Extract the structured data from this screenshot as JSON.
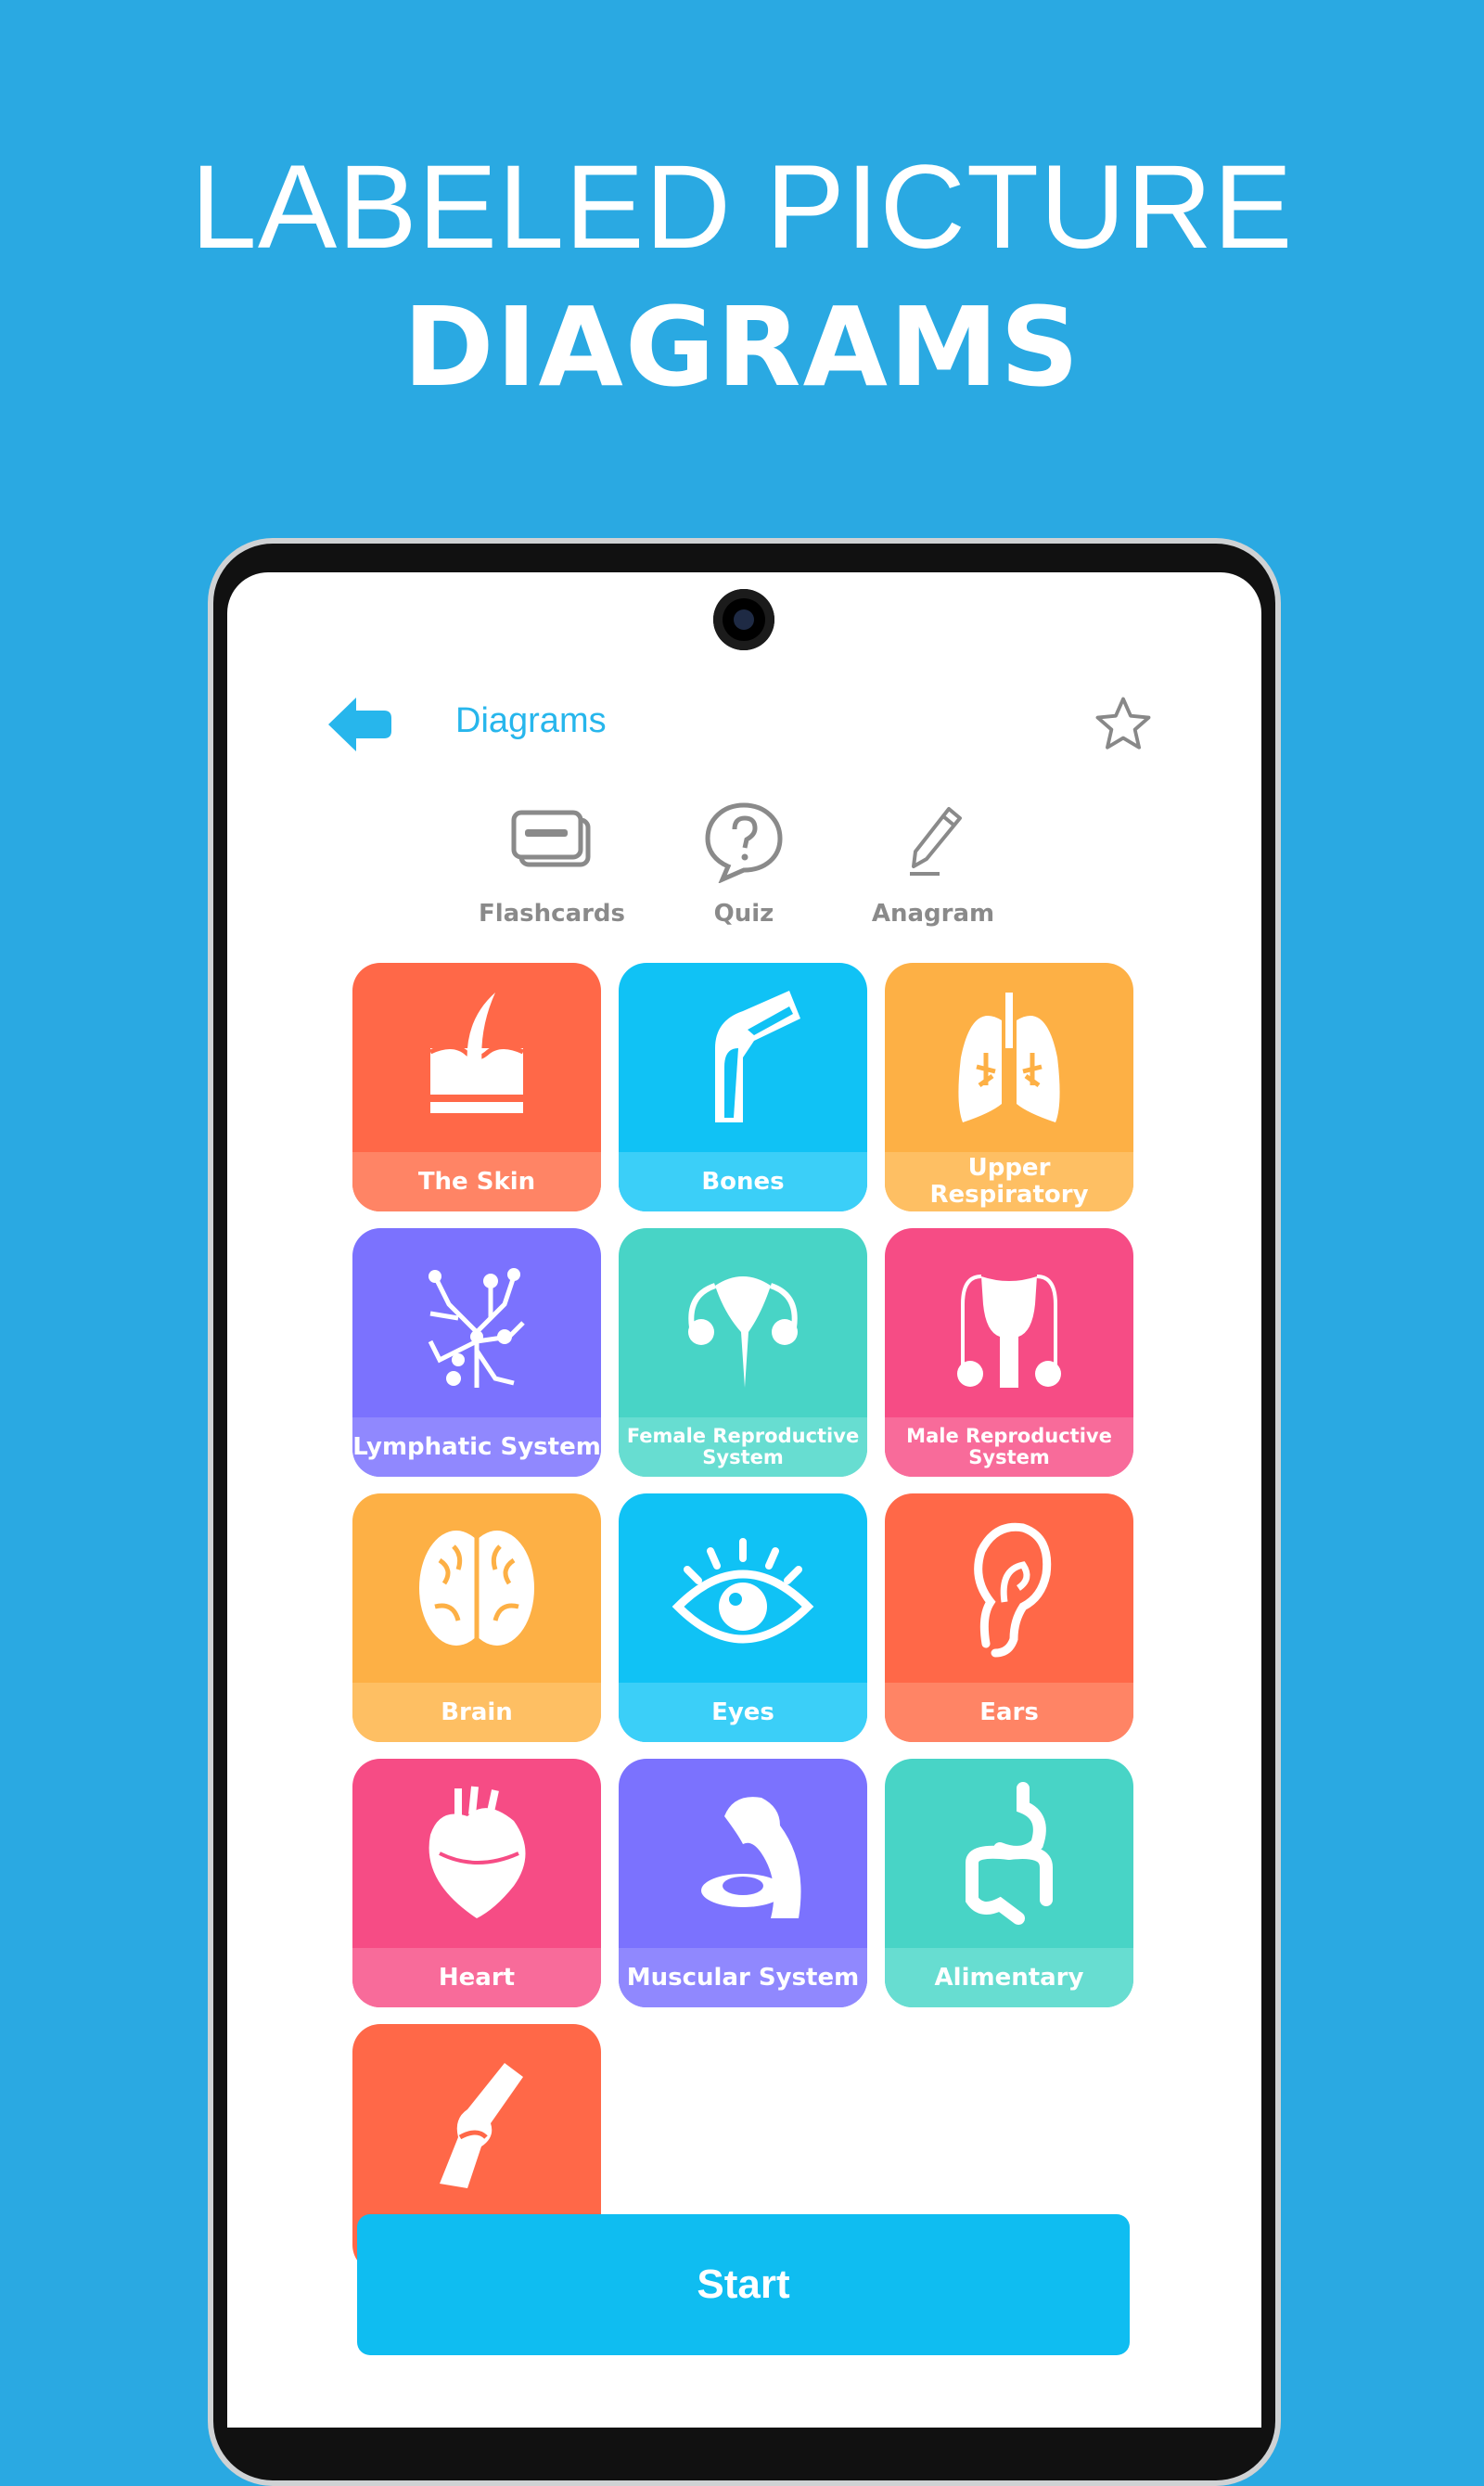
{
  "headline": {
    "line1": "LABELED PICTURE",
    "line2": "DIAGRAMS"
  },
  "header": {
    "title": "Diagrams",
    "back_icon": "arrow-left-icon",
    "favorite_icon": "star-outline-icon",
    "accent": "#27B6EC"
  },
  "modes": [
    {
      "label": "Flashcards",
      "icon": "flashcards-icon"
    },
    {
      "label": "Quiz",
      "icon": "question-bubble-icon"
    },
    {
      "label": "Anagram",
      "icon": "pencil-icon"
    }
  ],
  "tiles": [
    {
      "label": "The Skin",
      "icon": "skin-icon",
      "color": "#FF6848",
      "band": "#FF8465"
    },
    {
      "label": "Bones",
      "icon": "bone-joint-icon",
      "color": "#10C2F5",
      "band": "#3BCFF8"
    },
    {
      "label": "Upper Respiratory",
      "icon": "lungs-icon",
      "color": "#FDB045",
      "band": "#FEBF63"
    },
    {
      "label": "Lymphatic System",
      "icon": "lymph-icon",
      "color": "#7B72FE",
      "band": "#9088FE"
    },
    {
      "label": "Female Reproductive System",
      "icon": "uterus-icon",
      "color": "#48D4C6",
      "band": "#67DDD1"
    },
    {
      "label": "Male Reproductive System",
      "icon": "male-reproductive-icon",
      "color": "#F64C85",
      "band": "#F86B9A"
    },
    {
      "label": "Brain",
      "icon": "brain-icon",
      "color": "#FDB045",
      "band": "#FEBF63"
    },
    {
      "label": "Eyes",
      "icon": "eye-icon",
      "color": "#10C2F5",
      "band": "#3BCFF8"
    },
    {
      "label": "Ears",
      "icon": "ear-icon",
      "color": "#FF6848",
      "band": "#FF8465"
    },
    {
      "label": "Heart",
      "icon": "heart-icon",
      "color": "#F64C85",
      "band": "#F86B9A"
    },
    {
      "label": "Muscular System",
      "icon": "muscle-icon",
      "color": "#7B72FE",
      "band": "#9088FE"
    },
    {
      "label": "Alimentary",
      "icon": "intestine-icon",
      "color": "#48D4C6",
      "band": "#67DDD1"
    },
    {
      "label": "",
      "icon": "knee-icon",
      "color": "#FF6848",
      "band": "#FF6848"
    }
  ],
  "start_label": "Start",
  "colors": {
    "background": "#2AA9E2",
    "start": "#0FBDF1"
  }
}
